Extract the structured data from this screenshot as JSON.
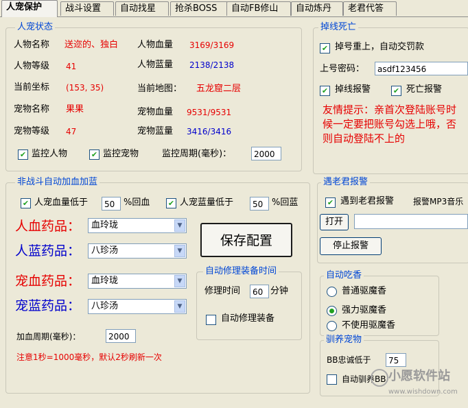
{
  "tabs": [
    "人宠保护",
    "战斗设置",
    "自动找星",
    "抢杀BOSS",
    "自动FB修山",
    "自动炼丹",
    "老君代答"
  ],
  "status": {
    "title": "人宠状态",
    "char_name_label": "人物名称",
    "char_name": "送迩的、独白",
    "char_hp_label": "人物血量",
    "char_hp": "3169/3169",
    "char_level_label": "人物等级",
    "char_level": "41",
    "char_mp_label": "人物蓝量",
    "char_mp": "2138/2138",
    "coord_label": "当前坐标",
    "coord": "(153, 35)",
    "map_label": "当前地图：",
    "map": "五龙窟二层",
    "pet_name_label": "宠物名称",
    "pet_name": "果果",
    "pet_hp_label": "宠物血量",
    "pet_hp": "9531/9531",
    "pet_level_label": "宠物等级",
    "pet_level": "47",
    "pet_mp_label": "宠物蓝量",
    "pet_mp": "3416/3416",
    "monitor_char": "监控人物",
    "monitor_pet": "监控宠物",
    "period_label": "监控周期(毫秒)：",
    "period_value": "2000"
  },
  "heal": {
    "title": "非战斗自动加血加蓝",
    "hp_check_label": "人宠血量低于",
    "hp_value": "50",
    "hp_suffix": "%回血",
    "mp_check_label": "人宠蓝量低于",
    "mp_value": "50",
    "mp_suffix": "%回蓝",
    "char_hp_drug_label": "人血药品：",
    "char_hp_drug": "血玲珑",
    "char_mp_drug_label": "人蓝药品：",
    "char_mp_drug": "八珍汤",
    "pet_hp_drug_label": "宠血药品：",
    "pet_hp_drug": "血玲珑",
    "pet_mp_drug_label": "宠蓝药品：",
    "pet_mp_drug": "八珍汤",
    "save_button": "保存配置",
    "period_label": "加血周期(毫秒)：",
    "period_value": "2000",
    "note": "注意1秒=1000毫秒，默认2秒刷新一次"
  },
  "repair": {
    "title": "自动修理装备时间",
    "time_label": "修理时间",
    "time_value": "60",
    "time_unit": "分钟",
    "auto_label": "自动修理装备"
  },
  "disconnect": {
    "title": "掉线死亡",
    "relogin_label": "掉号重上，自动交罚款",
    "password_label": "上号密码：",
    "password_value": "asdf123456",
    "disconnect_alarm": "掉线报警",
    "death_alarm": "死亡报警",
    "tip": "友情提示：亲首次登陆账号时候一定要把账号勾选上哦，否则自动登陆不上的"
  },
  "laojun": {
    "title": "遇老君报警",
    "alarm_label": "遇到老君报警",
    "mp3_label": "报警MP3音乐",
    "open_button": "打开",
    "path_value": "",
    "stop_button": "停止报警"
  },
  "incense": {
    "title": "自动吃香",
    "opt1": "普通驱魔香",
    "opt2": "强力驱魔香",
    "opt3": "不使用驱魔香"
  },
  "tame": {
    "title": "驯养宠物",
    "loyalty_label": "BB忠诚低于",
    "loyalty_value": "75",
    "auto_label": "自动驯养BB"
  },
  "watermark": {
    "text": "小愿软件站",
    "url": "www.wishdown.com"
  },
  "colors": {
    "legend_blue": "#0046d5",
    "value_red": "#e60000",
    "value_blue": "#0000cc",
    "check_green": "#21a121"
  }
}
